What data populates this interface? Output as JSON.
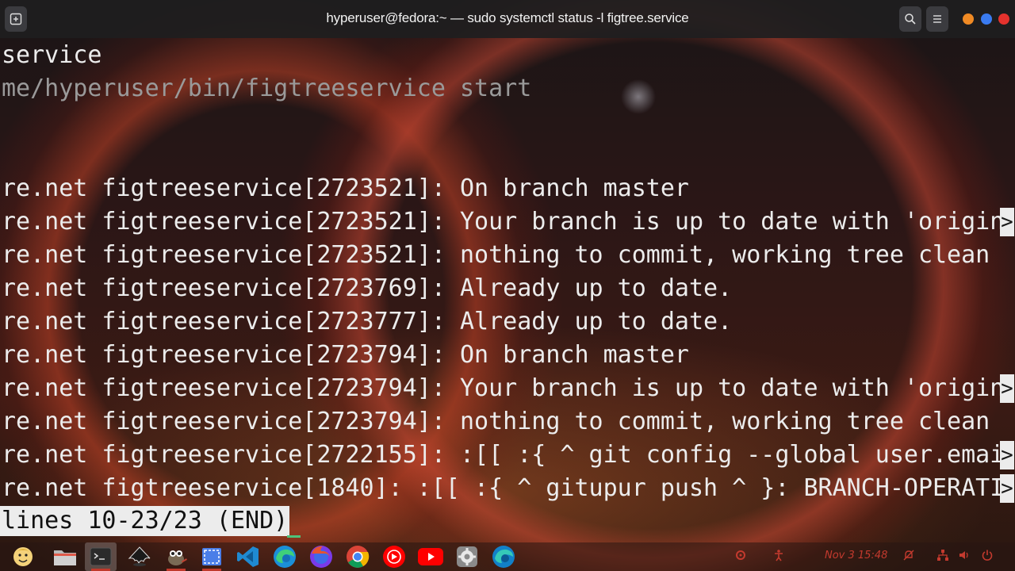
{
  "window": {
    "title": "hyperuser@fedora:~ — sudo systemctl status -l figtree.service",
    "traffic_colors": {
      "minimize": "#f08a24",
      "maximize": "#3a7bf0",
      "close": "#e5322d"
    }
  },
  "terminal": {
    "lines": [
      {
        "text": "service",
        "dim": false,
        "truncated": false
      },
      {
        "text": "me/hyperuser/bin/figtreeservice start",
        "dim": true,
        "truncated": false
      },
      {
        "text": "",
        "dim": false,
        "truncated": false
      },
      {
        "text": "",
        "dim": false,
        "truncated": false
      },
      {
        "text": "re.net figtreeservice[2723521]: On branch master",
        "dim": false,
        "truncated": false
      },
      {
        "text": "re.net figtreeservice[2723521]: Your branch is up to date with 'origin",
        "dim": false,
        "truncated": true
      },
      {
        "text": "re.net figtreeservice[2723521]: nothing to commit, working tree clean",
        "dim": false,
        "truncated": false
      },
      {
        "text": "re.net figtreeservice[2723769]: Already up to date.",
        "dim": false,
        "truncated": false
      },
      {
        "text": "re.net figtreeservice[2723777]: Already up to date.",
        "dim": false,
        "truncated": false
      },
      {
        "text": "re.net figtreeservice[2723794]: On branch master",
        "dim": false,
        "truncated": false
      },
      {
        "text": "re.net figtreeservice[2723794]: Your branch is up to date with 'origin",
        "dim": false,
        "truncated": true
      },
      {
        "text": "re.net figtreeservice[2723794]: nothing to commit, working tree clean",
        "dim": false,
        "truncated": false
      },
      {
        "text": "re.net figtreeservice[2722155]: :[[ :{ ^ git config --global user.emai",
        "dim": false,
        "truncated": true
      },
      {
        "text": "re.net figtreeservice[1840]: :[[ :{ ^ gitupur push ^ }: BRANCH-OPERATI",
        "dim": false,
        "truncated": true
      }
    ],
    "truncation_marker": ">",
    "status_line": "lines 10-23/23 (END)"
  },
  "dock": {
    "apps": [
      {
        "name": "fallout-vault-boy-icon",
        "active": false
      },
      {
        "name": "files-folder-icon",
        "active": false
      },
      {
        "name": "terminal-icon",
        "active": true
      },
      {
        "name": "inkscape-icon",
        "active": false
      },
      {
        "name": "gimp-icon",
        "active": false
      },
      {
        "name": "screenshot-tool-icon",
        "active": false
      },
      {
        "name": "vscode-icon",
        "active": false
      },
      {
        "name": "edge-icon",
        "active": false
      },
      {
        "name": "firefox-icon",
        "active": false
      },
      {
        "name": "chrome-icon",
        "active": false
      },
      {
        "name": "youtube-music-icon",
        "active": false
      },
      {
        "name": "youtube-icon",
        "active": false
      },
      {
        "name": "settings-gear-icon",
        "active": false
      },
      {
        "name": "edge-dev-icon",
        "active": false
      }
    ],
    "clock": "Nov 3  15:48",
    "tray_icons": [
      "remote-access-icon",
      "accessibility-icon",
      "notifications-off-icon",
      "network-icon",
      "volume-icon",
      "power-icon"
    ]
  }
}
